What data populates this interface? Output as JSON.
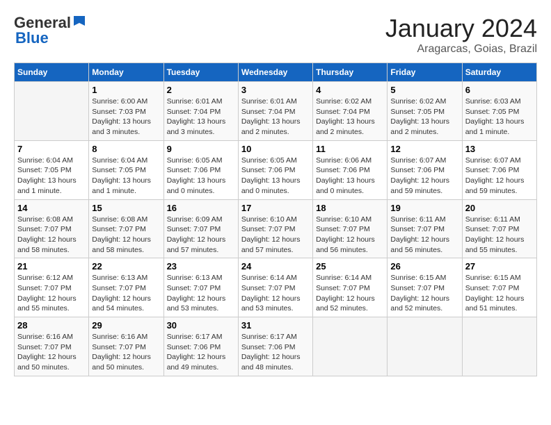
{
  "header": {
    "logo_general": "General",
    "logo_blue": "Blue",
    "month_title": "January 2024",
    "location": "Aragarcas, Goias, Brazil"
  },
  "columns": [
    "Sunday",
    "Monday",
    "Tuesday",
    "Wednesday",
    "Thursday",
    "Friday",
    "Saturday"
  ],
  "weeks": [
    {
      "days": [
        {
          "num": "",
          "info": ""
        },
        {
          "num": "1",
          "info": "Sunrise: 6:00 AM\nSunset: 7:03 PM\nDaylight: 13 hours\nand 3 minutes."
        },
        {
          "num": "2",
          "info": "Sunrise: 6:01 AM\nSunset: 7:04 PM\nDaylight: 13 hours\nand 3 minutes."
        },
        {
          "num": "3",
          "info": "Sunrise: 6:01 AM\nSunset: 7:04 PM\nDaylight: 13 hours\nand 2 minutes."
        },
        {
          "num": "4",
          "info": "Sunrise: 6:02 AM\nSunset: 7:04 PM\nDaylight: 13 hours\nand 2 minutes."
        },
        {
          "num": "5",
          "info": "Sunrise: 6:02 AM\nSunset: 7:05 PM\nDaylight: 13 hours\nand 2 minutes."
        },
        {
          "num": "6",
          "info": "Sunrise: 6:03 AM\nSunset: 7:05 PM\nDaylight: 13 hours\nand 1 minute."
        }
      ]
    },
    {
      "days": [
        {
          "num": "7",
          "info": "Sunrise: 6:04 AM\nSunset: 7:05 PM\nDaylight: 13 hours\nand 1 minute."
        },
        {
          "num": "8",
          "info": "Sunrise: 6:04 AM\nSunset: 7:05 PM\nDaylight: 13 hours\nand 1 minute."
        },
        {
          "num": "9",
          "info": "Sunrise: 6:05 AM\nSunset: 7:06 PM\nDaylight: 13 hours\nand 0 minutes."
        },
        {
          "num": "10",
          "info": "Sunrise: 6:05 AM\nSunset: 7:06 PM\nDaylight: 13 hours\nand 0 minutes."
        },
        {
          "num": "11",
          "info": "Sunrise: 6:06 AM\nSunset: 7:06 PM\nDaylight: 13 hours\nand 0 minutes."
        },
        {
          "num": "12",
          "info": "Sunrise: 6:07 AM\nSunset: 7:06 PM\nDaylight: 12 hours\nand 59 minutes."
        },
        {
          "num": "13",
          "info": "Sunrise: 6:07 AM\nSunset: 7:06 PM\nDaylight: 12 hours\nand 59 minutes."
        }
      ]
    },
    {
      "days": [
        {
          "num": "14",
          "info": "Sunrise: 6:08 AM\nSunset: 7:07 PM\nDaylight: 12 hours\nand 58 minutes."
        },
        {
          "num": "15",
          "info": "Sunrise: 6:08 AM\nSunset: 7:07 PM\nDaylight: 12 hours\nand 58 minutes."
        },
        {
          "num": "16",
          "info": "Sunrise: 6:09 AM\nSunset: 7:07 PM\nDaylight: 12 hours\nand 57 minutes."
        },
        {
          "num": "17",
          "info": "Sunrise: 6:10 AM\nSunset: 7:07 PM\nDaylight: 12 hours\nand 57 minutes."
        },
        {
          "num": "18",
          "info": "Sunrise: 6:10 AM\nSunset: 7:07 PM\nDaylight: 12 hours\nand 56 minutes."
        },
        {
          "num": "19",
          "info": "Sunrise: 6:11 AM\nSunset: 7:07 PM\nDaylight: 12 hours\nand 56 minutes."
        },
        {
          "num": "20",
          "info": "Sunrise: 6:11 AM\nSunset: 7:07 PM\nDaylight: 12 hours\nand 55 minutes."
        }
      ]
    },
    {
      "days": [
        {
          "num": "21",
          "info": "Sunrise: 6:12 AM\nSunset: 7:07 PM\nDaylight: 12 hours\nand 55 minutes."
        },
        {
          "num": "22",
          "info": "Sunrise: 6:13 AM\nSunset: 7:07 PM\nDaylight: 12 hours\nand 54 minutes."
        },
        {
          "num": "23",
          "info": "Sunrise: 6:13 AM\nSunset: 7:07 PM\nDaylight: 12 hours\nand 53 minutes."
        },
        {
          "num": "24",
          "info": "Sunrise: 6:14 AM\nSunset: 7:07 PM\nDaylight: 12 hours\nand 53 minutes."
        },
        {
          "num": "25",
          "info": "Sunrise: 6:14 AM\nSunset: 7:07 PM\nDaylight: 12 hours\nand 52 minutes."
        },
        {
          "num": "26",
          "info": "Sunrise: 6:15 AM\nSunset: 7:07 PM\nDaylight: 12 hours\nand 52 minutes."
        },
        {
          "num": "27",
          "info": "Sunrise: 6:15 AM\nSunset: 7:07 PM\nDaylight: 12 hours\nand 51 minutes."
        }
      ]
    },
    {
      "days": [
        {
          "num": "28",
          "info": "Sunrise: 6:16 AM\nSunset: 7:07 PM\nDaylight: 12 hours\nand 50 minutes."
        },
        {
          "num": "29",
          "info": "Sunrise: 6:16 AM\nSunset: 7:07 PM\nDaylight: 12 hours\nand 50 minutes."
        },
        {
          "num": "30",
          "info": "Sunrise: 6:17 AM\nSunset: 7:06 PM\nDaylight: 12 hours\nand 49 minutes."
        },
        {
          "num": "31",
          "info": "Sunrise: 6:17 AM\nSunset: 7:06 PM\nDaylight: 12 hours\nand 48 minutes."
        },
        {
          "num": "",
          "info": ""
        },
        {
          "num": "",
          "info": ""
        },
        {
          "num": "",
          "info": ""
        }
      ]
    }
  ]
}
